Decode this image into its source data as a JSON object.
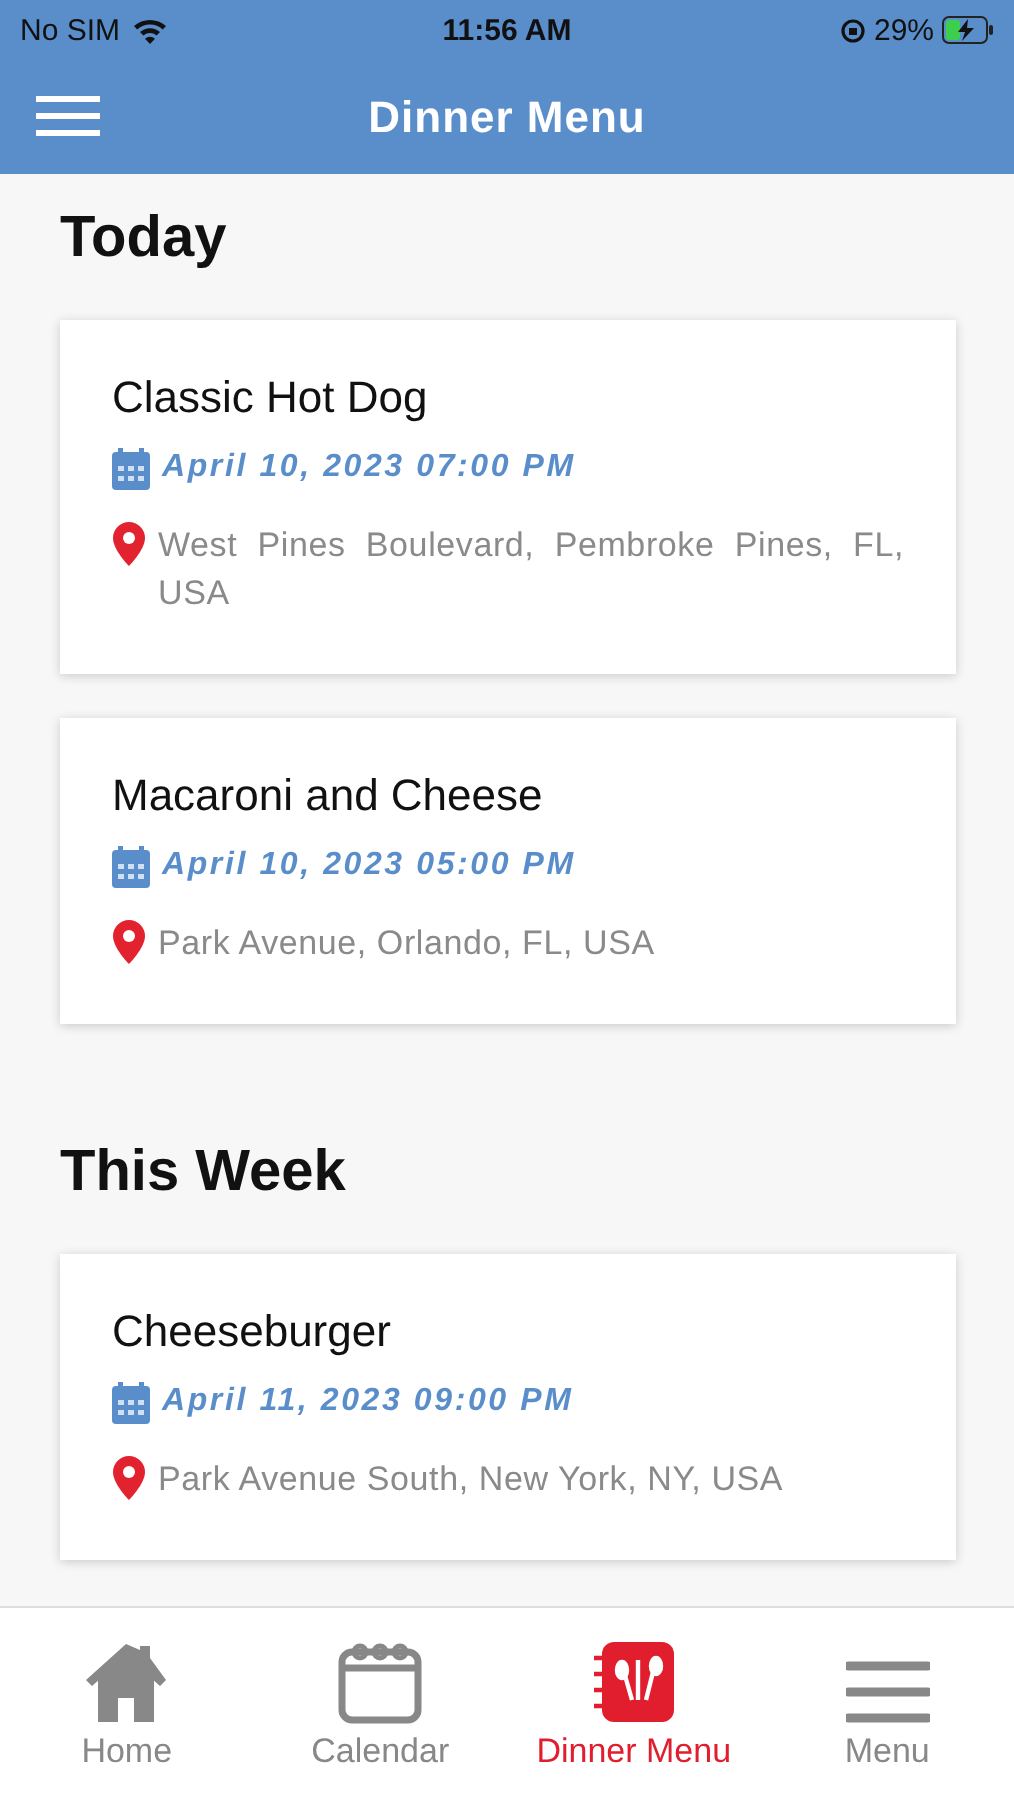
{
  "status_bar": {
    "carrier": "No SIM",
    "time": "11:56 AM",
    "battery": "29%"
  },
  "header": {
    "title": "Dinner Menu"
  },
  "sections": [
    {
      "title": "Today",
      "meals": [
        {
          "name": "Classic Hot Dog",
          "datetime": "April 10, 2023 07:00 PM",
          "location": "West Pines Boulevard, Pembroke Pines, FL, USA"
        },
        {
          "name": "Macaroni and Cheese",
          "datetime": "April 10, 2023 05:00 PM",
          "location": "Park Avenue, Orlando, FL, USA"
        }
      ]
    },
    {
      "title": "This Week",
      "meals": [
        {
          "name": "Cheeseburger",
          "datetime": "April 11, 2023 09:00 PM",
          "location": "Park Avenue South, New York, NY, USA"
        }
      ]
    }
  ],
  "tab_bar": [
    {
      "kind": "home",
      "label": "Home",
      "selected": false
    },
    {
      "kind": "calendar",
      "label": "Calendar",
      "selected": false
    },
    {
      "kind": "dinner",
      "label": "Dinner Menu",
      "selected": true
    },
    {
      "kind": "menu",
      "label": "Menu",
      "selected": false
    }
  ]
}
